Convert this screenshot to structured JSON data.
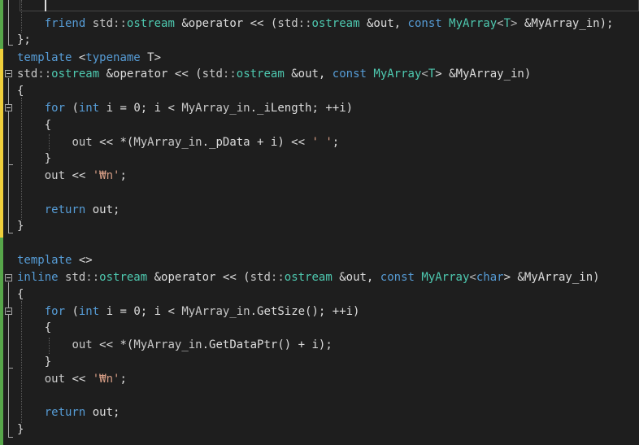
{
  "colors": {
    "background": "#1e1e1e",
    "keyword": "#569cd6",
    "type": "#4ec9b0",
    "plain": "#dcdcdc",
    "string": "#d69d85",
    "change_saved": "#57a64a",
    "change_unsaved": "#efcf3b"
  },
  "code": {
    "l1": {
      "friend": "friend",
      "std": "std",
      "ostream": "ostream",
      "op": "&operator << (",
      "std2": "std",
      "ostream2": "ostream",
      "out": "&out, ",
      "const": "const",
      "myarray": "MyArray",
      "lt": "<",
      "T": "T",
      "gt": ">",
      "rest": " &MyArray_in);"
    },
    "l2": {
      "text": "};"
    },
    "l3": {
      "template": "template",
      "lt": " <",
      "typename": "typename",
      "rest": " T>"
    },
    "l4": {
      "std": "std",
      "ostream": "ostream",
      "op": " &operator << (",
      "std2": "std",
      "ostream2": "ostream",
      "out": " &out, ",
      "const": "const",
      "myarray": "MyArray",
      "lt": "<",
      "T": "T",
      "rest": "> &MyArray_in)"
    },
    "l5": {
      "text": "{"
    },
    "l6": {
      "for": "for",
      "open": " (",
      "int": "int",
      "rest1": " i = 0; i < ",
      "arr": "MyArray_in",
      "rest2": "._iLength; ++i)"
    },
    "l7": {
      "text": "{"
    },
    "l8": {
      "out": "out",
      "rest1": " << *(",
      "arr": "MyArray_in",
      "rest2": "._pData + i) << ",
      "str": "' '",
      "end": ";"
    },
    "l9": {
      "text": "}"
    },
    "l10": {
      "out": "out",
      "rest": " << ",
      "str": "'₩n'",
      "end": ";"
    },
    "l12": {
      "return": "return",
      "rest": " out;"
    },
    "l13": {
      "text": "}"
    },
    "l15": {
      "template": "template",
      "rest": " <>"
    },
    "l16": {
      "inline": "inline",
      "std": " std",
      "ostream": "ostream",
      "op": " &operator << (",
      "std2": "std",
      "ostream2": "ostream",
      "out": " &out, ",
      "const": "const",
      "myarray": "MyArray",
      "lt": "<",
      "char": "char",
      "rest": "> &MyArray_in)"
    },
    "l17": {
      "text": "{"
    },
    "l18": {
      "for": "for",
      "open": " (",
      "int": "int",
      "rest1": " i = 0; i < ",
      "arr": "MyArray_in",
      "rest2": ".GetSize(); ++i)"
    },
    "l19": {
      "text": "{"
    },
    "l20": {
      "out": "out",
      "rest1": " << *(",
      "arr": "MyArray_in",
      "rest2": ".GetDataPtr() + i);"
    },
    "l21": {
      "text": "}"
    },
    "l22": {
      "out": "out",
      "rest": " << ",
      "str": "'₩n'",
      "end": ";"
    },
    "l24": {
      "return": "return",
      "rest": " out;"
    },
    "l25": {
      "text": "}"
    }
  }
}
